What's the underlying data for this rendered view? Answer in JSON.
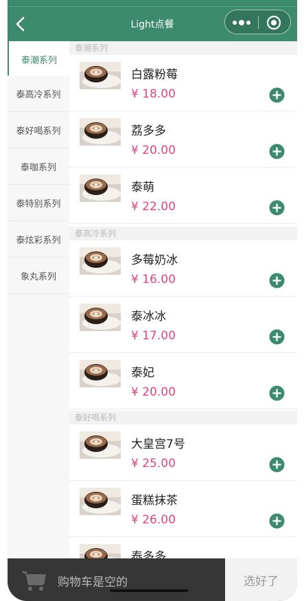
{
  "header": {
    "title": "Light点餐",
    "color": "#3d8b6e"
  },
  "sidebar": {
    "items": [
      {
        "label": "泰潮系列",
        "active": true
      },
      {
        "label": "泰高冷系列"
      },
      {
        "label": "泰好喝系列"
      },
      {
        "label": "泰咖系列"
      },
      {
        "label": "泰特别系列"
      },
      {
        "label": "泰炫彩系列"
      },
      {
        "label": "象丸系列"
      }
    ]
  },
  "sections": [
    {
      "title": "泰潮系列",
      "items": [
        {
          "name": "白露粉莓",
          "price": "¥ 18.00"
        },
        {
          "name": "荔多多",
          "price": "¥ 20.00"
        },
        {
          "name": "泰萌",
          "price": "¥ 22.00"
        }
      ]
    },
    {
      "title": "泰高冷系列",
      "items": [
        {
          "name": "多莓奶冰",
          "price": "¥ 16.00"
        },
        {
          "name": "泰冰冰",
          "price": "¥ 17.00"
        },
        {
          "name": "泰妃",
          "price": "¥ 20.00"
        }
      ]
    },
    {
      "title": "泰好喝系列",
      "items": [
        {
          "name": "大皇宫7号",
          "price": "¥ 25.00"
        },
        {
          "name": "蛋糕抹茶",
          "price": "¥ 26.00"
        },
        {
          "name": "泰多多",
          "price": ""
        }
      ]
    }
  ],
  "cart": {
    "text": "购物车是空的",
    "button": "选好了"
  },
  "icons": {
    "back": "back-arrow-icon",
    "more": "more-dots-icon",
    "close": "close-circle-icon",
    "add": "add-circle-icon",
    "cart": "cart-icon",
    "thumb": "latte-thumbnail"
  },
  "colors": {
    "accent": "#3d8b6e",
    "price": "#e0447f",
    "cartbar": "#363636"
  }
}
